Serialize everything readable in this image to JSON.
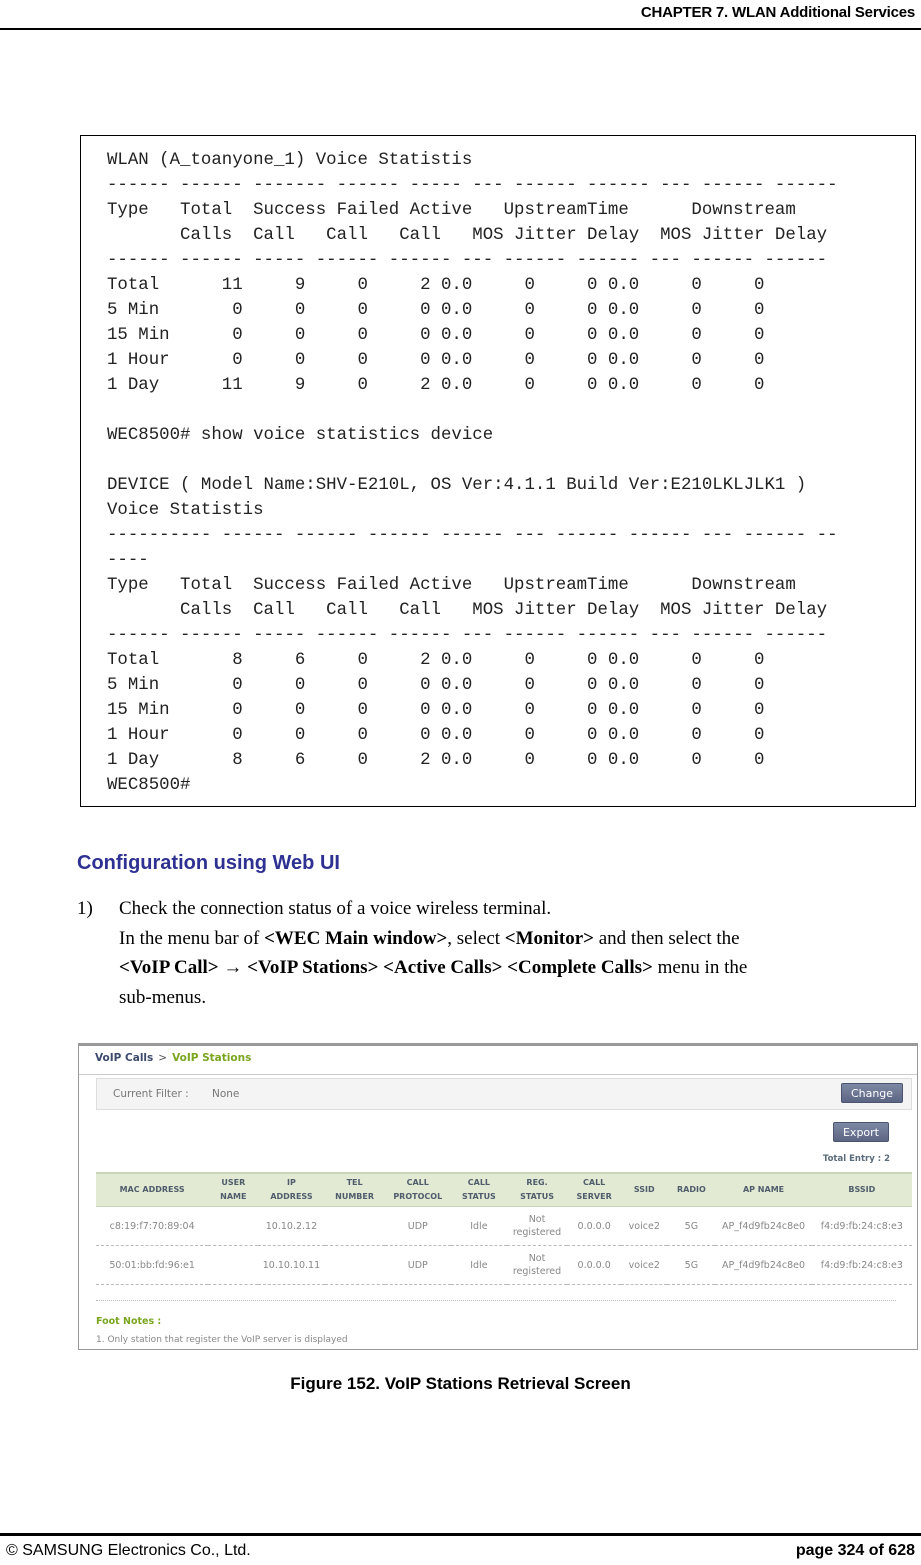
{
  "header": {
    "chapter_title": "CHAPTER 7. WLAN Additional Services"
  },
  "terminal": {
    "lines": [
      "WLAN (A_toanyone_1) Voice Statistis",
      "------ ------ ------- ------ ----- --- ------ ------ --- ------ ------",
      "Type   Total  Success Failed Active   UpstreamTime      Downstream",
      "       Calls  Call   Call   Call   MOS Jitter Delay  MOS Jitter Delay",
      "------ ------ ----- ------ ------ --- ------ ------ --- ------ ------",
      "Total      11     9     0     2 0.0     0     0 0.0     0     0",
      "5 Min       0     0     0     0 0.0     0     0 0.0     0     0",
      "15 Min      0     0     0     0 0.0     0     0 0.0     0     0",
      "1 Hour      0     0     0     0 0.0     0     0 0.0     0     0",
      "1 Day      11     9     0     2 0.0     0     0 0.0     0     0",
      "",
      "WEC8500# show voice statistics device",
      "",
      "DEVICE ( Model Name:SHV-E210L, OS Ver:4.1.1 Build Ver:E210LKLJLK1 )",
      "Voice Statistis",
      "---------- ------ ------ ------ ------ --- ------ ------ --- ------ --",
      "----",
      "Type   Total  Success Failed Active   UpstreamTime      Downstream",
      "       Calls  Call   Call   Call   MOS Jitter Delay  MOS Jitter Delay",
      "------ ------ ----- ------ ------ --- ------ ------ --- ------ ------",
      "Total       8     6     0     2 0.0     0     0 0.0     0     0",
      "5 Min       0     0     0     0 0.0     0     0 0.0     0     0",
      "15 Min      0     0     0     0 0.0     0     0 0.0     0     0",
      "1 Hour      0     0     0     0 0.0     0     0 0.0     0     0",
      "1 Day       8     6     0     2 0.0     0     0 0.0     0     0",
      "WEC8500#"
    ]
  },
  "section": {
    "title": "Configuration using Web UI",
    "step_number": "1)",
    "step_line1": "Check the connection status of a voice wireless terminal.",
    "step_line2_pre": "In the menu bar of ",
    "step_line2_b1": "<WEC Main window>",
    "step_line2_mid": ", select ",
    "step_line2_b2": "<Monitor>",
    "step_line2_post": " and then select the",
    "step_line3_b1": "<VoIP Call> → <VoIP Stations> <Active Calls> <Complete Calls>",
    "step_line3_post": " menu in the",
    "step_line4": "sub-menus."
  },
  "screenshot": {
    "breadcrumb": {
      "parent": "VoIP Calls",
      "separator": ">",
      "current": "VoIP Stations"
    },
    "filter": {
      "label": "Current Filter :",
      "value": "None",
      "change_button": "Change"
    },
    "export_button": "Export",
    "total_entry": "Total Entry : 2",
    "columns": [
      [
        "MAC ADDRESS"
      ],
      [
        "USER",
        "NAME"
      ],
      [
        "IP",
        "ADDRESS"
      ],
      [
        "TEL",
        "NUMBER"
      ],
      [
        "CALL",
        "PROTOCOL"
      ],
      [
        "CALL",
        "STATUS"
      ],
      [
        "REG.",
        "STATUS"
      ],
      [
        "CALL",
        "SERVER"
      ],
      [
        "SSID"
      ],
      [
        "RADIO"
      ],
      [
        "AP NAME"
      ],
      [
        "BSSID"
      ]
    ],
    "rows": [
      {
        "mac": "c8:19:f7:70:89:04",
        "user": "",
        "ip": "10.10.2.12",
        "tel": "",
        "protocol": "UDP",
        "call_status": "Idle",
        "reg_status_1": "Not",
        "reg_status_2": "registered",
        "server": "0.0.0.0",
        "ssid": "voice2",
        "radio": "5G",
        "ap_name": "AP_f4d9fb24c8e0",
        "bssid": "f4:d9:fb:24:c8:e3"
      },
      {
        "mac": "50:01:bb:fd:96:e1",
        "user": "",
        "ip": "10.10.10.11",
        "tel": "",
        "protocol": "UDP",
        "call_status": "Idle",
        "reg_status_1": "Not",
        "reg_status_2": "registered",
        "server": "0.0.0.0",
        "ssid": "voice2",
        "radio": "5G",
        "ap_name": "AP_f4d9fb24c8e0",
        "bssid": "f4:d9:fb:24:c8:e3"
      }
    ],
    "foot_notes_title": "Foot Notes :",
    "foot_note_1": "1. Only station that register the VoIP server is displayed"
  },
  "caption": "Figure 152. VoIP Stations Retrieval Screen",
  "footer": {
    "copyright": "© SAMSUNG Electronics Co., Ltd.",
    "page": "page 324 of 628"
  }
}
